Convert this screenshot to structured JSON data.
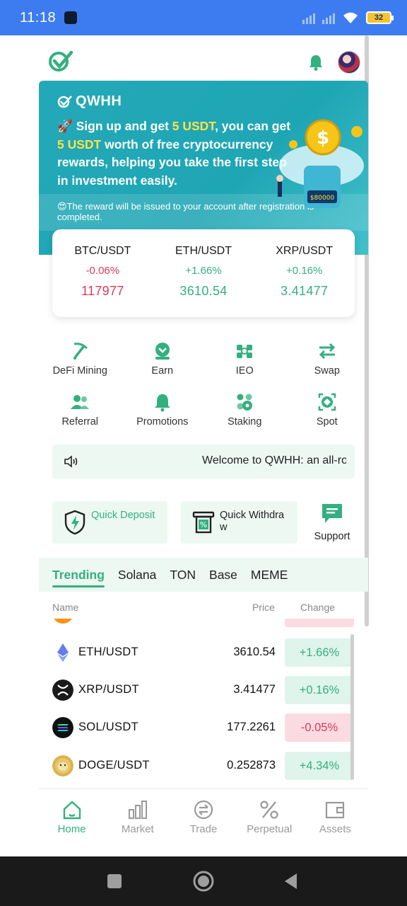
{
  "status_bar": {
    "time": "11:18",
    "battery": "32"
  },
  "banner": {
    "brand": "QWHH",
    "line_prefix": "🚀 Sign up and get ",
    "highlight_1": "5 USDT",
    "line_middle": ", you can get ",
    "highlight_2": "5 USDT",
    "line_suffix": " worth of free cryptocurrency rewards, helping you take the first step in investment easily.",
    "note": "😍The reward will be issued to your account after registration is completed.",
    "art_label": "$80000"
  },
  "tickers": [
    {
      "pair": "BTC/USDT",
      "change": "-0.06%",
      "price": "117977",
      "trend": "neg"
    },
    {
      "pair": "ETH/USDT",
      "change": "+1.66%",
      "price": "3610.54",
      "trend": "pos"
    },
    {
      "pair": "XRP/USDT",
      "change": "+0.16%",
      "price": "3.41477",
      "trend": "pos"
    }
  ],
  "menu": [
    {
      "label": "DeFi Mining",
      "icon": "pickaxe-icon"
    },
    {
      "label": "Earn",
      "icon": "earn-icon"
    },
    {
      "label": "IEO",
      "icon": "ieo-icon"
    },
    {
      "label": "Swap",
      "icon": "swap-icon"
    },
    {
      "label": "Referral",
      "icon": "referral-icon"
    },
    {
      "label": "Promotions",
      "icon": "bell-icon"
    },
    {
      "label": "Staking",
      "icon": "staking-icon"
    },
    {
      "label": "Spot",
      "icon": "spot-icon"
    }
  ],
  "notice": {
    "text": "Welcome to QWHH: an all-ro"
  },
  "quick_actions": {
    "deposit": "Quick Deposit",
    "withdraw": "Quick Withdraw",
    "support": "Support"
  },
  "tabs": [
    "Trending",
    "Solana",
    "TON",
    "Base",
    "MEME"
  ],
  "columns": {
    "name": "Name",
    "price": "Price",
    "change": "Change"
  },
  "markets": [
    {
      "pair": "ETH/USDT",
      "price": "3610.54",
      "change": "+1.66%",
      "trend": "pos",
      "icon": "eth-icon"
    },
    {
      "pair": "XRP/USDT",
      "price": "3.41477",
      "change": "+0.16%",
      "trend": "pos",
      "icon": "xrp-icon"
    },
    {
      "pair": "SOL/USDT",
      "price": "177.2261",
      "change": "-0.05%",
      "trend": "neg",
      "icon": "sol-icon"
    },
    {
      "pair": "DOGE/USDT",
      "price": "0.252873",
      "change": "+4.34%",
      "trend": "pos",
      "icon": "doge-icon"
    }
  ],
  "bottom_nav": [
    {
      "label": "Home",
      "icon": "home-icon",
      "active": true
    },
    {
      "label": "Market",
      "icon": "market-icon",
      "active": false
    },
    {
      "label": "Trade",
      "icon": "trade-icon",
      "active": false
    },
    {
      "label": "Perpetual",
      "icon": "perpetual-icon",
      "active": false
    },
    {
      "label": "Assets",
      "icon": "assets-icon",
      "active": false
    }
  ],
  "colors": {
    "accent": "#33b07f",
    "negative": "#d63a5b",
    "banner": "#23a8b8",
    "status_bar": "#3d7cf0"
  }
}
